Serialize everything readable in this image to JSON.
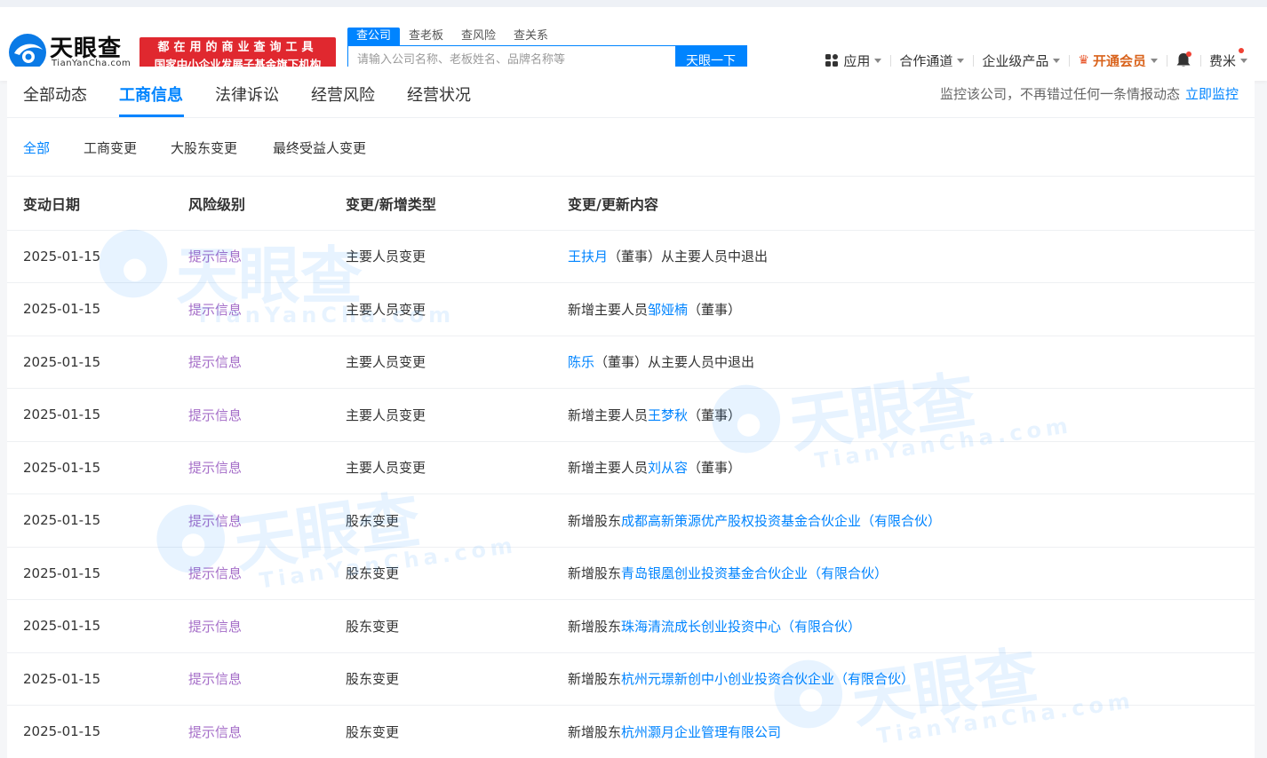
{
  "header": {
    "logo_text": "天眼查",
    "logo_sub": "TianYanCha.com",
    "slogan_line1": "都在用的商业查询工具",
    "slogan_line2": "国家中小企业发展子基金旗下机构",
    "search_tabs": [
      "查公司",
      "查老板",
      "查风险",
      "查关系"
    ],
    "search_placeholder": "请输入公司名称、老板姓名、品牌名称等",
    "search_button": "天眼一下",
    "nav": {
      "apps": "应用",
      "channel": "合作通道",
      "enterprise": "企业级产品",
      "vip": "开通会员",
      "user": "费米"
    }
  },
  "main_tabs": [
    "全部动态",
    "工商信息",
    "法律诉讼",
    "经营风险",
    "经营状况"
  ],
  "monitor_text": "监控该公司，不再错过任何一条情报动态",
  "monitor_link": "立即监控",
  "sub_tabs": [
    "全部",
    "工商变更",
    "大股东变更",
    "最终受益人变更"
  ],
  "table": {
    "headers": [
      "变动日期",
      "风险级别",
      "变更/新增类型",
      "变更/更新内容"
    ],
    "rows": [
      {
        "date": "2025-01-15",
        "risk": "提示信息",
        "type": "主要人员变更",
        "pre": "",
        "link": "王扶月",
        "post": "（董事）从主要人员中退出"
      },
      {
        "date": "2025-01-15",
        "risk": "提示信息",
        "type": "主要人员变更",
        "pre": "新增主要人员",
        "link": "邹娅楠",
        "post": "（董事）"
      },
      {
        "date": "2025-01-15",
        "risk": "提示信息",
        "type": "主要人员变更",
        "pre": "",
        "link": "陈乐",
        "post": "（董事）从主要人员中退出"
      },
      {
        "date": "2025-01-15",
        "risk": "提示信息",
        "type": "主要人员变更",
        "pre": "新增主要人员",
        "link": "王梦秋",
        "post": "（董事）"
      },
      {
        "date": "2025-01-15",
        "risk": "提示信息",
        "type": "主要人员变更",
        "pre": "新增主要人员",
        "link": "刘从容",
        "post": "（董事）"
      },
      {
        "date": "2025-01-15",
        "risk": "提示信息",
        "type": "股东变更",
        "pre": "新增股东",
        "link": "成都高新策源优产股权投资基金合伙企业（有限合伙）",
        "post": ""
      },
      {
        "date": "2025-01-15",
        "risk": "提示信息",
        "type": "股东变更",
        "pre": "新增股东",
        "link": "青岛银凰创业投资基金合伙企业（有限合伙）",
        "post": ""
      },
      {
        "date": "2025-01-15",
        "risk": "提示信息",
        "type": "股东变更",
        "pre": "新增股东",
        "link": "珠海清流成长创业投资中心（有限合伙）",
        "post": ""
      },
      {
        "date": "2025-01-15",
        "risk": "提示信息",
        "type": "股东变更",
        "pre": "新增股东",
        "link": "杭州元璟新创中小创业投资合伙企业（有限合伙）",
        "post": ""
      },
      {
        "date": "2025-01-15",
        "risk": "提示信息",
        "type": "股东变更",
        "pre": "新增股东",
        "link": "杭州灏月企业管理有限公司",
        "post": ""
      }
    ]
  },
  "watermark": {
    "text": "天眼查",
    "sub": "TianYanCha.com"
  },
  "colors": {
    "accent": "#0084ff",
    "risk": "#a56ec8",
    "brand_red": "#e0282f",
    "vip": "#d9631c"
  }
}
